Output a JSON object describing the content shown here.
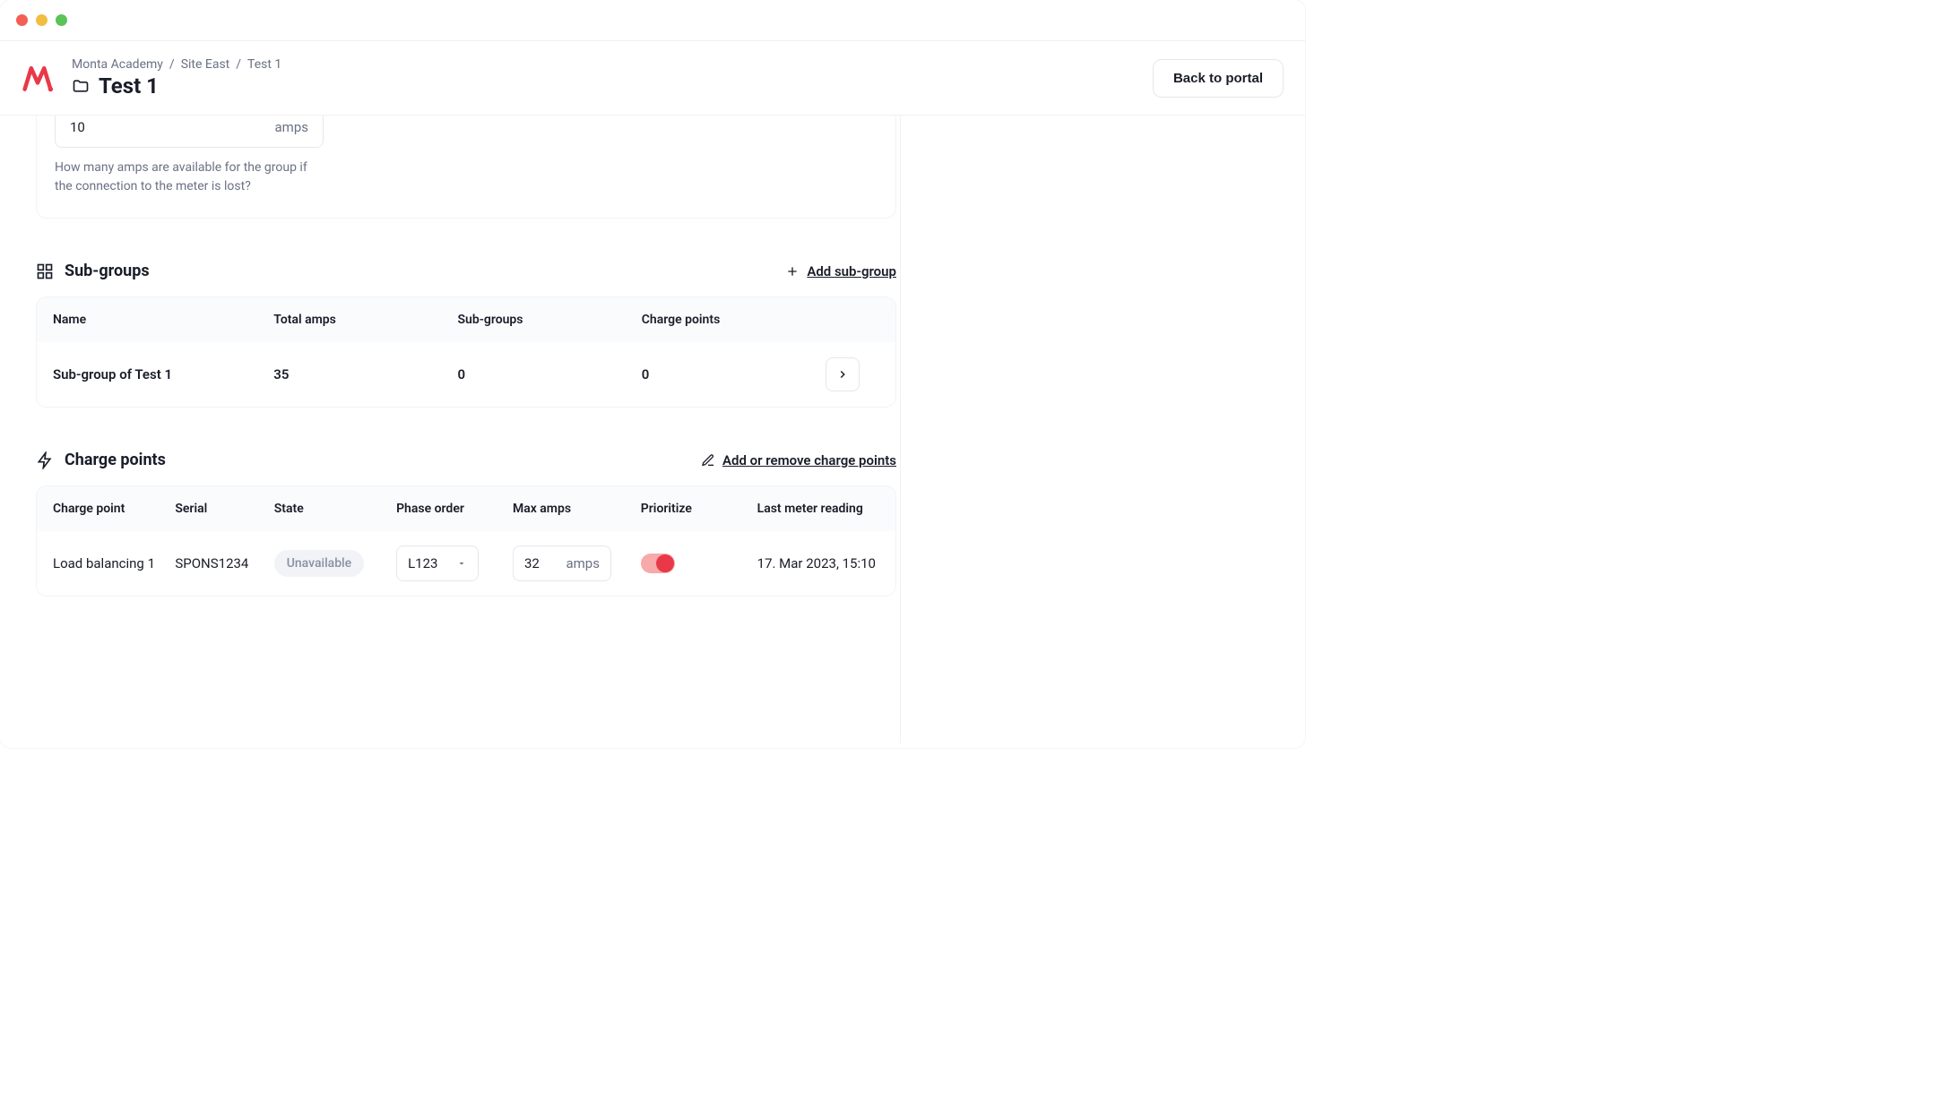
{
  "breadcrumbs": [
    "Monta Academy",
    "Site East",
    "Test 1"
  ],
  "page_title": "Test 1",
  "back_button": "Back to portal",
  "fallback": {
    "value": "10",
    "unit": "amps",
    "help": "How many amps are available for the group if the connection to the meter is lost?"
  },
  "subgroups": {
    "title": "Sub-groups",
    "add_label": "Add sub-group",
    "columns": [
      "Name",
      "Total amps",
      "Sub-groups",
      "Charge points"
    ],
    "rows": [
      {
        "name": "Sub-group of Test 1",
        "total_amps": "35",
        "subgroups": "0",
        "charge_points": "0"
      }
    ]
  },
  "charge_points": {
    "title": "Charge points",
    "add_label": "Add or remove charge points",
    "columns": [
      "Charge point",
      "Serial",
      "State",
      "Phase order",
      "Max amps",
      "Prioritize",
      "Last meter reading"
    ],
    "rows": [
      {
        "name": "Load balancing 1",
        "serial": "SPONS1234",
        "state": "Unavailable",
        "phase_order": "L123",
        "max_amps": "32",
        "max_amps_unit": "amps",
        "prioritize": true,
        "last_meter": "17. Mar 2023, 15:10"
      }
    ]
  }
}
